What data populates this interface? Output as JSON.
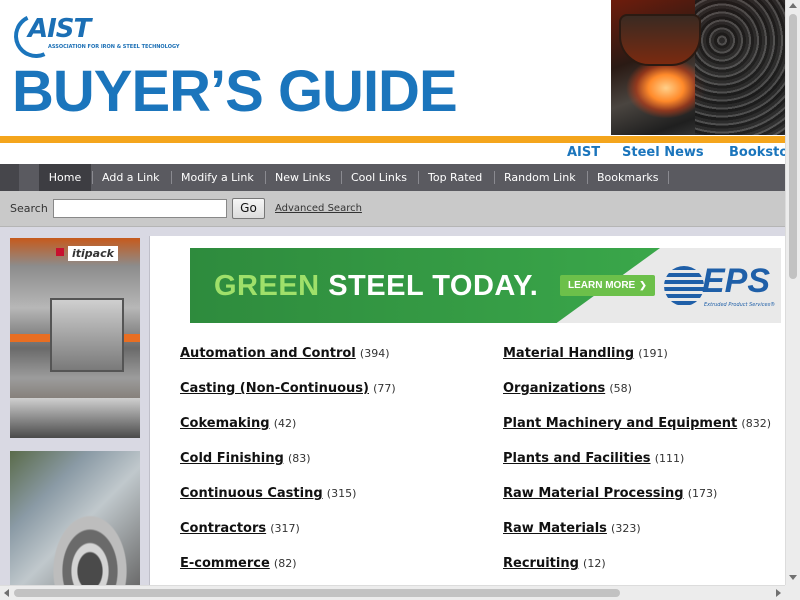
{
  "header": {
    "logo_text": "AIST",
    "logo_subtext": "ASSOCIATION FOR IRON & STEEL TECHNOLOGY",
    "title": "BUYER’S GUIDE"
  },
  "top_links": [
    "AIST",
    "Steel News",
    "Bookstore"
  ],
  "nav": {
    "items": [
      "Home",
      "Add a Link",
      "Modify a Link",
      "New Links",
      "Cool Links",
      "Top Rated",
      "Random Link",
      "Bookmarks"
    ],
    "active": "Home"
  },
  "search": {
    "label": "Search",
    "value": "",
    "button": "Go",
    "advanced": "Advanced Search"
  },
  "side_ads": [
    {
      "brand": "itipack"
    },
    {
      "brand": ""
    }
  ],
  "banner": {
    "headline_accent": "GREEN",
    "headline_rest": "STEEL TODAY.",
    "cta": "LEARN MORE",
    "cta_arrow": "❯",
    "brand": "EPS",
    "brand_tagline": "Extruded Product Services®"
  },
  "categories": {
    "left": [
      {
        "name": "Automation and Control",
        "count": "(394)"
      },
      {
        "name": "Casting (Non-Continuous)",
        "count": "(77)"
      },
      {
        "name": "Cokemaking",
        "count": "(42)"
      },
      {
        "name": "Cold Finishing",
        "count": "(83)"
      },
      {
        "name": "Continuous Casting",
        "count": "(315)"
      },
      {
        "name": "Contractors",
        "count": "(317)"
      },
      {
        "name": "E-commerce",
        "count": "(82)"
      }
    ],
    "right": [
      {
        "name": "Material Handling",
        "count": "(191)"
      },
      {
        "name": "Organizations",
        "count": "(58)"
      },
      {
        "name": "Plant Machinery and Equipment",
        "count": "(832)"
      },
      {
        "name": "Plants and Facilities",
        "count": "(111)"
      },
      {
        "name": "Raw Material Processing",
        "count": "(173)"
      },
      {
        "name": "Raw Materials",
        "count": "(323)"
      },
      {
        "name": "Recruiting",
        "count": "(12)"
      }
    ]
  },
  "colors": {
    "brand_blue": "#1b75bc",
    "accent_orange": "#f4a51c",
    "nav_bg": "#5a5a60",
    "banner_green": "#3aa74a"
  },
  "scroll": {
    "vertical_position": 0.0,
    "horizontal_position": 0.0
  }
}
